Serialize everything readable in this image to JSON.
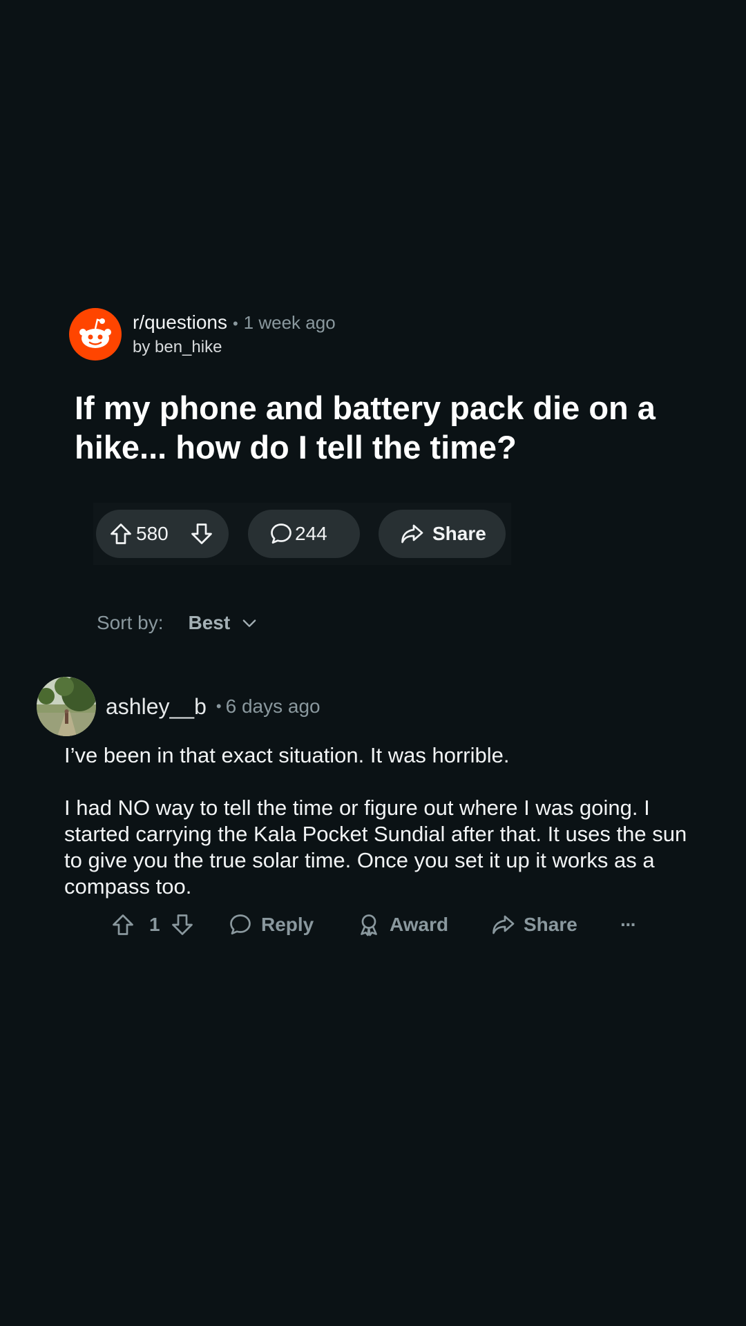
{
  "post": {
    "subreddit": "r/questions",
    "separator": "•",
    "time": "1 week ago",
    "author": "by ben_hike",
    "title": "If my phone and battery pack die on a hike... how do I tell the time?",
    "upvotes": "580",
    "comments": "244",
    "share_label": "Share"
  },
  "sort": {
    "label": "Sort by:",
    "value": "Best"
  },
  "comment": {
    "author": "ashley__b",
    "separator": "•",
    "time": "6 days ago",
    "paragraphs": [
      "I’ve been in that exact situation. It was horrible.",
      "I had NO way to tell the time or figure out where I was going. I started carrying the Kala Pocket Sundial after that. It uses the sun to give you the true solar time. Once you set it up it works as a compass too."
    ],
    "votes": "1",
    "reply_label": "Reply",
    "award_label": "Award",
    "share_label": "Share",
    "more_label": "···"
  },
  "colors": {
    "background": "#0b1215",
    "brand": "#ff4500",
    "pill": "#283033",
    "muted": "#8a989e"
  },
  "icons": [
    "reddit-logo-icon",
    "upvote-icon",
    "downvote-icon",
    "comment-icon",
    "share-icon",
    "chevron-down-icon",
    "award-icon",
    "more-icon"
  ]
}
